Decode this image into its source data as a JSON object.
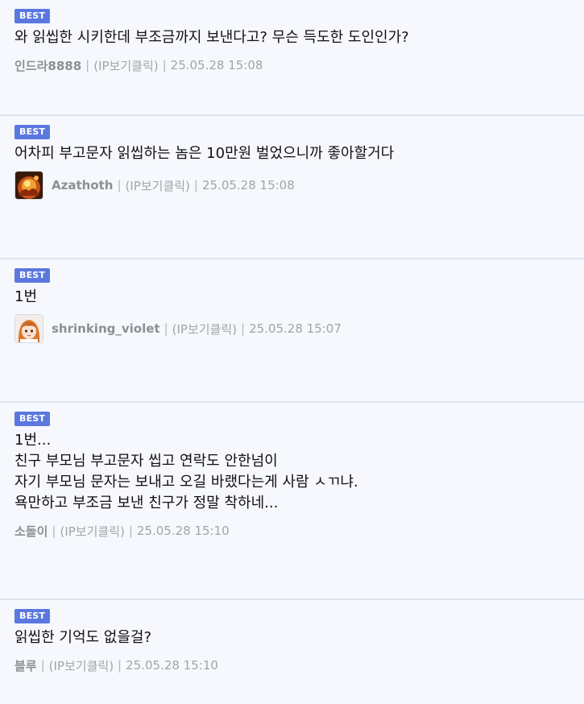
{
  "comments": [
    {
      "badge": "BEST",
      "text": "와 읽씹한 시키한데 부조금까지 보낸다고? 무슨 득도한 도인인가?",
      "author": "인드라8888",
      "ip_label": "(IP보기클릭)",
      "sep": "|",
      "time": "25.05.28 15:08"
    },
    {
      "badge": "BEST",
      "text": "어차피 부고문자 읽씹하는 놈은 10만원 벌었으니까 좋아할거다",
      "author": "Azathoth",
      "ip_label": "(IP보기클릭)",
      "sep": "|",
      "time": "25.05.28 15:08",
      "avatar_icon": "fire-character-avatar"
    },
    {
      "badge": "BEST",
      "text": "1번",
      "author": "shrinking_violet",
      "ip_label": "(IP보기클릭)",
      "sep": "|",
      "time": "25.05.28 15:07",
      "avatar_icon": "anime-girl-avatar"
    },
    {
      "badge": "BEST",
      "text": "1번...\n친구 부모님 부고문자 씹고 연락도 안한넘이\n자기 부모님 문자는 보내고 오길 바랬다는게 사람 ㅅㄲ냐.\n욕만하고 부조금 보낸 친구가 정말 착하네...",
      "author": "소돌이",
      "ip_label": "(IP보기클릭)",
      "sep": "|",
      "time": "25.05.28 15:10"
    },
    {
      "badge": "BEST",
      "text": "읽씹한 기억도 없을걸?",
      "author": "블루",
      "ip_label": "(IP보기클릭)",
      "sep": "|",
      "time": "25.05.28 15:10"
    }
  ],
  "colors": {
    "badge_bg": "#5b78e0",
    "page_bg": "#f6f8fd",
    "divider": "#dfe2ea",
    "meta_text": "#a2a4a9"
  }
}
